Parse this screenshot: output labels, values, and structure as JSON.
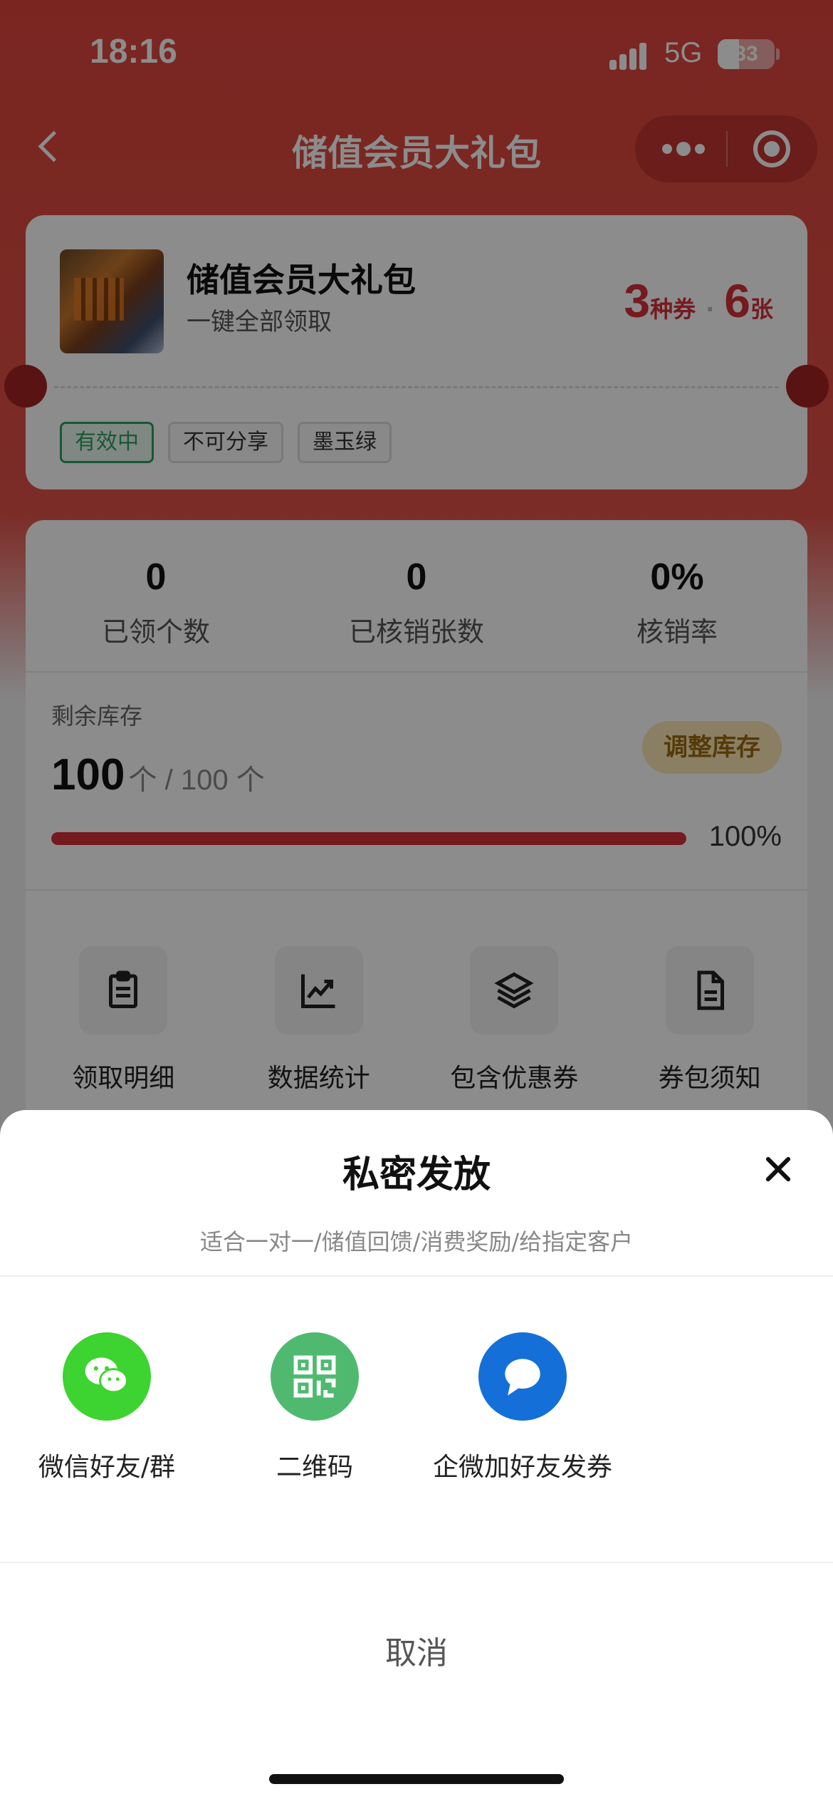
{
  "status_bar": {
    "time": "18:16",
    "network": "5G",
    "battery": "33"
  },
  "nav": {
    "title": "储值会员大礼包"
  },
  "pack": {
    "title": "储值会员大礼包",
    "subtitle": "一键全部领取",
    "coupon_types_count": "3",
    "coupon_types_unit": "种券",
    "separator": "·",
    "coupon_sheets_count": "6",
    "coupon_sheets_unit": "张",
    "tags": [
      "有效中",
      "不可分享",
      "墨玉绿"
    ]
  },
  "stats": [
    {
      "value": "0",
      "label": "已领个数"
    },
    {
      "value": "0",
      "label": "已核销张数"
    },
    {
      "value": "0%",
      "label": "核销率"
    }
  ],
  "stock": {
    "label": "剩余库存",
    "remaining": "100",
    "suffix": "个 / 100 个",
    "adjust_label": "调整库存",
    "progress_fraction": 1.0,
    "percent_text": "100%"
  },
  "actions": [
    {
      "label": "领取明细",
      "icon": "clipboard-icon"
    },
    {
      "label": "数据统计",
      "icon": "trend-chart-icon"
    },
    {
      "label": "包含优惠券",
      "icon": "layers-icon"
    },
    {
      "label": "券包须知",
      "icon": "document-icon"
    }
  ],
  "sheet": {
    "title": "私密发放",
    "subtitle": "适合一对一/储值回馈/消费奖励/给指定客户",
    "options": [
      {
        "label": "微信好友/群",
        "icon": "wechat-icon",
        "color": "#3dd330"
      },
      {
        "label": "二维码",
        "icon": "qrcode-icon",
        "color": "#4fba6f"
      },
      {
        "label": "企微加好友发券",
        "icon": "chat-bubble-icon",
        "color": "#1470d8"
      }
    ],
    "cancel_label": "取消"
  },
  "colors": {
    "brand_red": "#e0443d",
    "accent_red": "#d6303a",
    "tag_green": "#2f9e62"
  }
}
